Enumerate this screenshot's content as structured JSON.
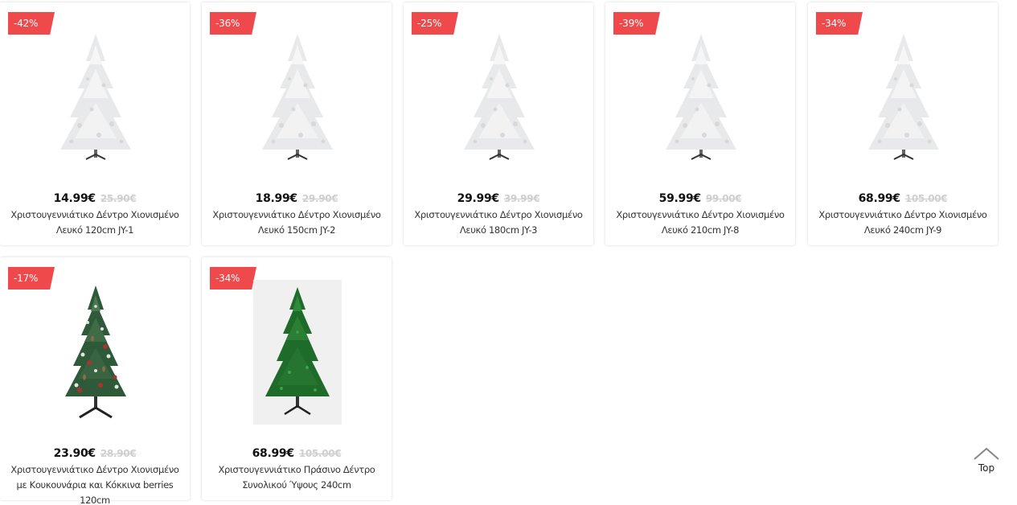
{
  "products": [
    {
      "discount": "-42%",
      "price": "14.99€",
      "old_price": "25.90€",
      "title": "Χριστουγεννιάτικο Δέντρο Χιονισμένο Λευκό 120cm JY-1",
      "image": "white-christmas-tree"
    },
    {
      "discount": "-36%",
      "price": "18.99€",
      "old_price": "29.90€",
      "title": "Χριστουγεννιάτικο Δέντρο Χιονισμένο Λευκό 150cm JY-2",
      "image": "white-christmas-tree"
    },
    {
      "discount": "-25%",
      "price": "29.99€",
      "old_price": "39.99€",
      "title": "Χριστουγεννιάτικο Δέντρο Χιονισμένο Λευκό 180cm JY-3",
      "image": "white-christmas-tree"
    },
    {
      "discount": "-39%",
      "price": "59.99€",
      "old_price": "99.00€",
      "title": "Χριστουγεννιάτικο Δέντρο Χιονισμένο Λευκό 210cm JY-8",
      "image": "white-christmas-tree"
    },
    {
      "discount": "-34%",
      "price": "68.99€",
      "old_price": "105.00€",
      "title": "Χριστουγεννιάτικο Δέντρο Χιονισμένο Λευκό 240cm JY-9",
      "image": "white-christmas-tree"
    },
    {
      "discount": "-17%",
      "price": "23.90€",
      "old_price": "28.90€",
      "title": "Χριστουγεννιάτικο Δέντρο Χιονισμένο με Κουκουνάρια και Κόκκινα berries 120cm",
      "image": "pinecone-berries-tree"
    },
    {
      "discount": "-34%",
      "price": "68.99€",
      "old_price": "105.00€",
      "title": "Χριστουγεννιάτικο Πράσινο Δέντρο Συνολικού Ύψους 240cm",
      "image": "green-christmas-tree"
    }
  ],
  "back_to_top": {
    "label": "Top",
    "icon": "chevron-up-icon"
  },
  "colors": {
    "badge": "#f0494c",
    "price": "#111111",
    "old_price": "#cfcfcf"
  }
}
